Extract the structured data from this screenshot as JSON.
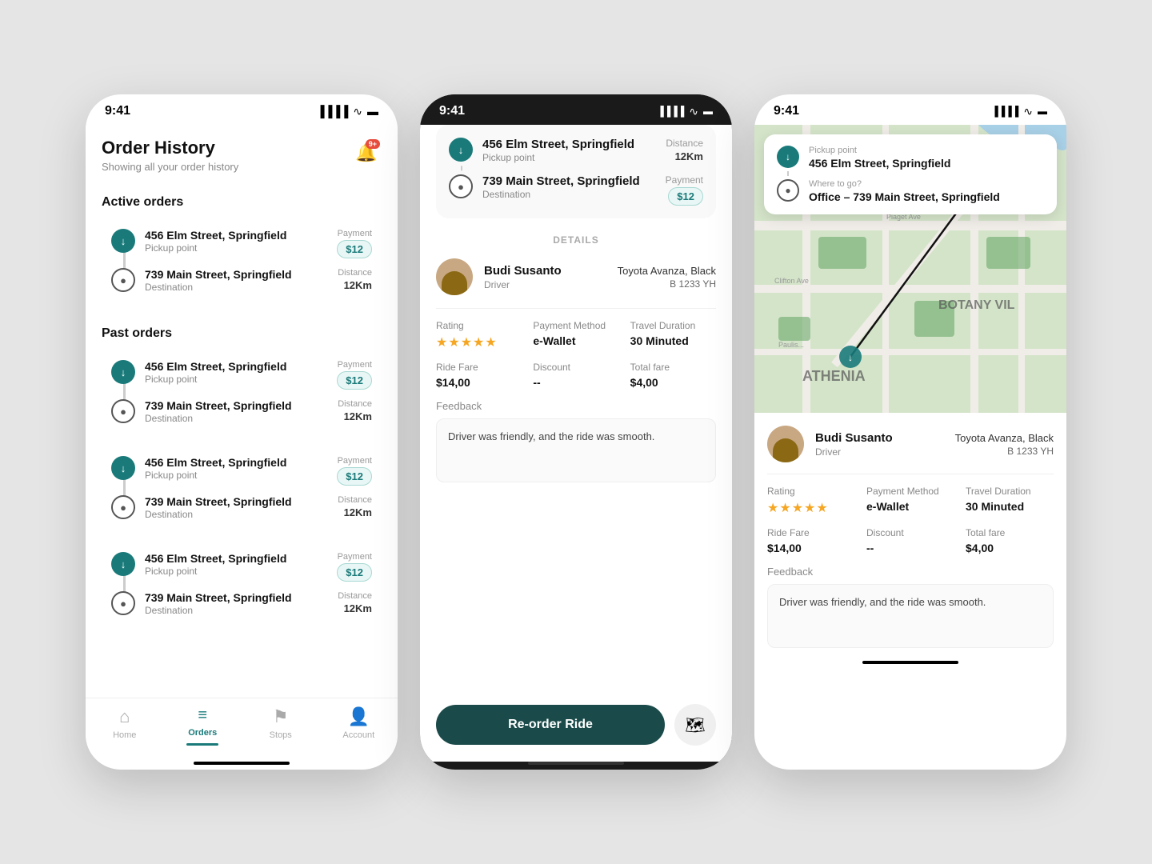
{
  "phone1": {
    "status_time": "9:41",
    "bell_badge": "9+",
    "title": "Order History",
    "subtitle": "Showing all your order history",
    "active_section": "Active orders",
    "past_section": "Past orders",
    "active_orders": [
      {
        "pickup_addr": "456 Elm Street, Springfield",
        "pickup_type": "Pickup point",
        "dest_addr": "739 Main Street, Springfield",
        "dest_type": "Destination",
        "payment_label": "Payment",
        "payment_val": "$12",
        "distance_label": "Distance",
        "distance_val": "12Km"
      }
    ],
    "past_orders": [
      {
        "pickup_addr": "456 Elm Street, Springfield",
        "pickup_type": "Pickup point",
        "dest_addr": "739 Main Street, Springfield",
        "dest_type": "Destination",
        "payment_label": "Payment",
        "payment_val": "$12",
        "distance_label": "Distance",
        "distance_val": "12Km"
      },
      {
        "pickup_addr": "456 Elm Street, Springfield",
        "pickup_type": "Pickup point",
        "dest_addr": "739 Main Street, Springfield",
        "dest_type": "Destination",
        "payment_label": "Payment",
        "payment_val": "$12",
        "distance_label": "Distance",
        "distance_val": "12Km"
      },
      {
        "pickup_addr": "456 Elm Street, Springfield",
        "pickup_type": "Pickup point",
        "dest_addr": "739 Main Street, Springfield",
        "dest_type": "Destination",
        "payment_label": "Payment",
        "payment_val": "$12",
        "distance_label": "Distance",
        "distance_val": "12Km"
      }
    ],
    "nav": {
      "items": [
        {
          "id": "home",
          "label": "Home",
          "icon": "⌂",
          "active": false
        },
        {
          "id": "orders",
          "label": "Orders",
          "icon": "☰",
          "active": true
        },
        {
          "id": "stops",
          "label": "Stops",
          "icon": "⚑",
          "active": false
        },
        {
          "id": "account",
          "label": "Account",
          "icon": "👤",
          "active": false
        }
      ]
    }
  },
  "phone2": {
    "status_time": "9:41",
    "trip": {
      "pickup_addr": "456 Elm Street, Springfield",
      "pickup_label": "Pickup point",
      "dest_addr": "739 Main Street, Springfield",
      "dest_label": "Destination",
      "distance_label": "Distance",
      "distance_val": "12Km",
      "payment_label": "Payment",
      "payment_val": "$12"
    },
    "details_heading": "DETAILS",
    "driver": {
      "name": "Budi Susanto",
      "role": "Driver",
      "vehicle": "Toyota Avanza, Black",
      "plate": "B 1233 YH"
    },
    "stats": {
      "rating_label": "Rating",
      "rating_stars": "★★★★★",
      "payment_method_label": "Payment Method",
      "payment_method_val": "e-Wallet",
      "travel_duration_label": "Travel Duration",
      "travel_duration_val": "30 Minuted",
      "ride_fare_label": "Ride Fare",
      "ride_fare_val": "$14,00",
      "discount_label": "Discount",
      "discount_val": "--",
      "total_fare_label": "Total fare",
      "total_fare_val": "$4,00"
    },
    "feedback_label": "Feedback",
    "feedback_text": "Driver was friendly, and the ride was smooth.",
    "reorder_btn": "Re-order Ride"
  },
  "phone3": {
    "status_time": "9:41",
    "pickup_label": "Pickup point",
    "pickup_addr": "456 Elm Street, Springfield",
    "destination_label": "Where to go?",
    "destination_addr": "Office – 739 Main Street, Springfield",
    "driver": {
      "name": "Budi Susanto",
      "role": "Driver",
      "vehicle": "Toyota Avanza, Black",
      "plate": "B 1233 YH"
    },
    "stats": {
      "rating_label": "Rating",
      "rating_stars": "★★★★★",
      "payment_method_label": "Payment Method",
      "payment_method_val": "e-Wallet",
      "travel_duration_label": "Travel Duration",
      "travel_duration_val": "30 Minuted",
      "ride_fare_label": "Ride Fare",
      "ride_fare_val": "$14,00",
      "discount_label": "Discount",
      "discount_val": "--",
      "total_fare_label": "Total fare",
      "total_fare_val": "$4,00"
    },
    "feedback_label": "Feedback",
    "feedback_text": "Driver was friendly, and the ride was smooth."
  }
}
